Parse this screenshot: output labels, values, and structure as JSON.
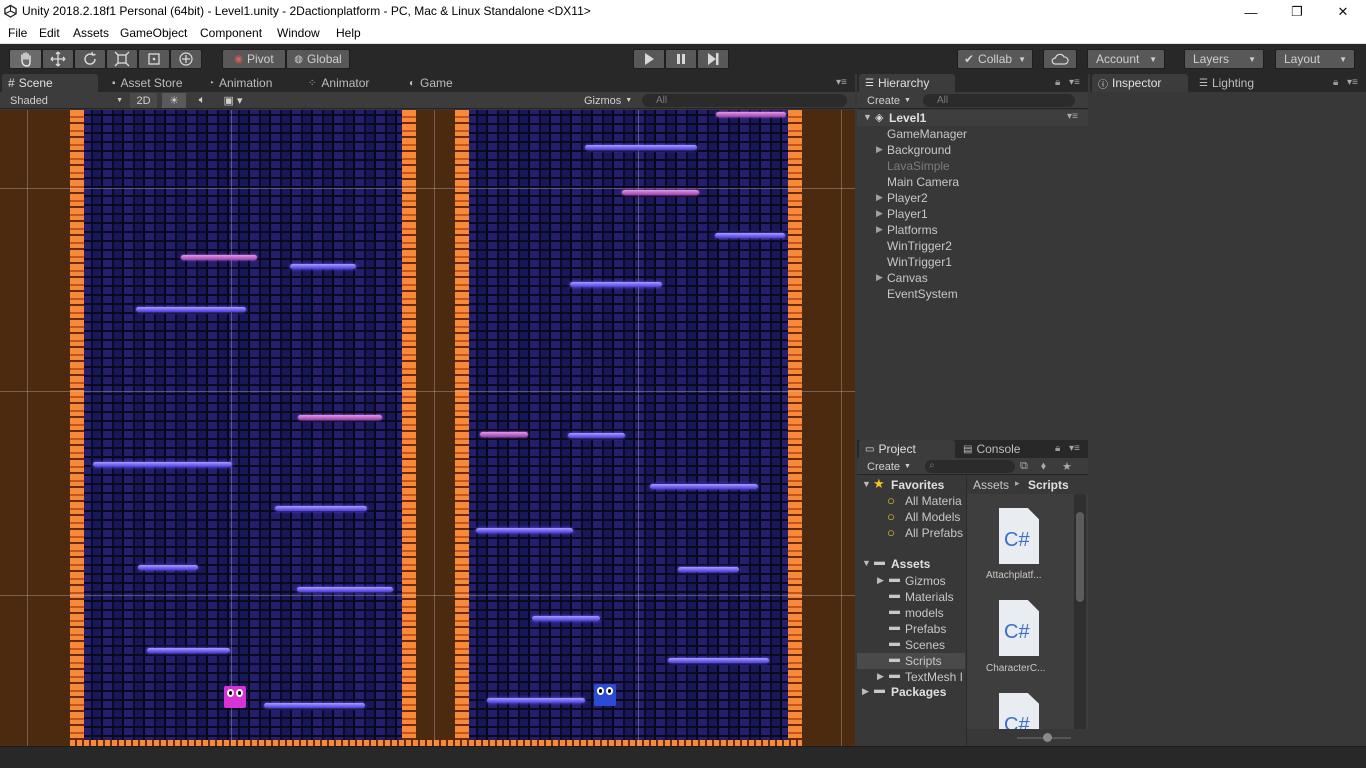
{
  "window": {
    "title": "Unity 2018.2.18f1 Personal (64bit) - Level1.unity - 2Dactionplatform - PC, Mac & Linux Standalone <DX11>",
    "minimize": "—",
    "maximize": "❐",
    "close": "✕"
  },
  "menu": [
    "File",
    "Edit",
    "Assets",
    "GameObject",
    "Component",
    "Window",
    "Help"
  ],
  "toolbar": {
    "pivot": "Pivot",
    "global": "Global",
    "collab": "Collab",
    "account": "Account",
    "layers": "Layers",
    "layout": "Layout"
  },
  "scene_tabs": [
    "Scene",
    "Asset Store",
    "Animation",
    "Animator",
    "Game"
  ],
  "scene_bar": {
    "shading": "Shaded",
    "mode2d": "2D",
    "gizmos": "Gizmos",
    "search_placeholder": "All"
  },
  "hierarchy": {
    "tab": "Hierarchy",
    "create": "Create",
    "search_placeholder": "All",
    "scene": "Level1",
    "items": [
      {
        "label": "GameManager",
        "expandable": false,
        "dim": false
      },
      {
        "label": "Background",
        "expandable": true,
        "dim": false
      },
      {
        "label": "LavaSimple",
        "expandable": false,
        "dim": true
      },
      {
        "label": "Main Camera",
        "expandable": false,
        "dim": false
      },
      {
        "label": "Player2",
        "expandable": true,
        "dim": false
      },
      {
        "label": "Player1",
        "expandable": true,
        "dim": false
      },
      {
        "label": "Platforms",
        "expandable": true,
        "dim": false
      },
      {
        "label": "WinTrigger2",
        "expandable": false,
        "dim": false
      },
      {
        "label": "WinTrigger1",
        "expandable": false,
        "dim": false
      },
      {
        "label": "Canvas",
        "expandable": true,
        "dim": false
      },
      {
        "label": "EventSystem",
        "expandable": false,
        "dim": false
      }
    ]
  },
  "project": {
    "tab": "Project",
    "console_tab": "Console",
    "create": "Create",
    "favorites": "Favorites",
    "favorite_items": [
      "All Materia",
      "All Models",
      "All Prefabs"
    ],
    "assets": "Assets",
    "folders": [
      "Gizmos",
      "Materials",
      "models",
      "Prefabs",
      "Scenes",
      "Scripts",
      "TextMesh I"
    ],
    "packages": "Packages",
    "breadcrumb": {
      "root": "Assets",
      "sep": "▸",
      "current": "Scripts"
    },
    "files": [
      {
        "icon_text": "C#",
        "name": "Attachplatf..."
      },
      {
        "icon_text": "C#",
        "name": "CharacterC..."
      },
      {
        "icon_text": "C#",
        "name": ""
      }
    ]
  },
  "inspector": {
    "tab": "Inspector",
    "lighting_tab": "Lighting"
  },
  "colors": {
    "accent_blue": "#4b3ddd",
    "accent_pink": "#9c3fae",
    "player1": "#d633d6",
    "player2": "#2b4bd6",
    "wall": "#f7893a"
  }
}
